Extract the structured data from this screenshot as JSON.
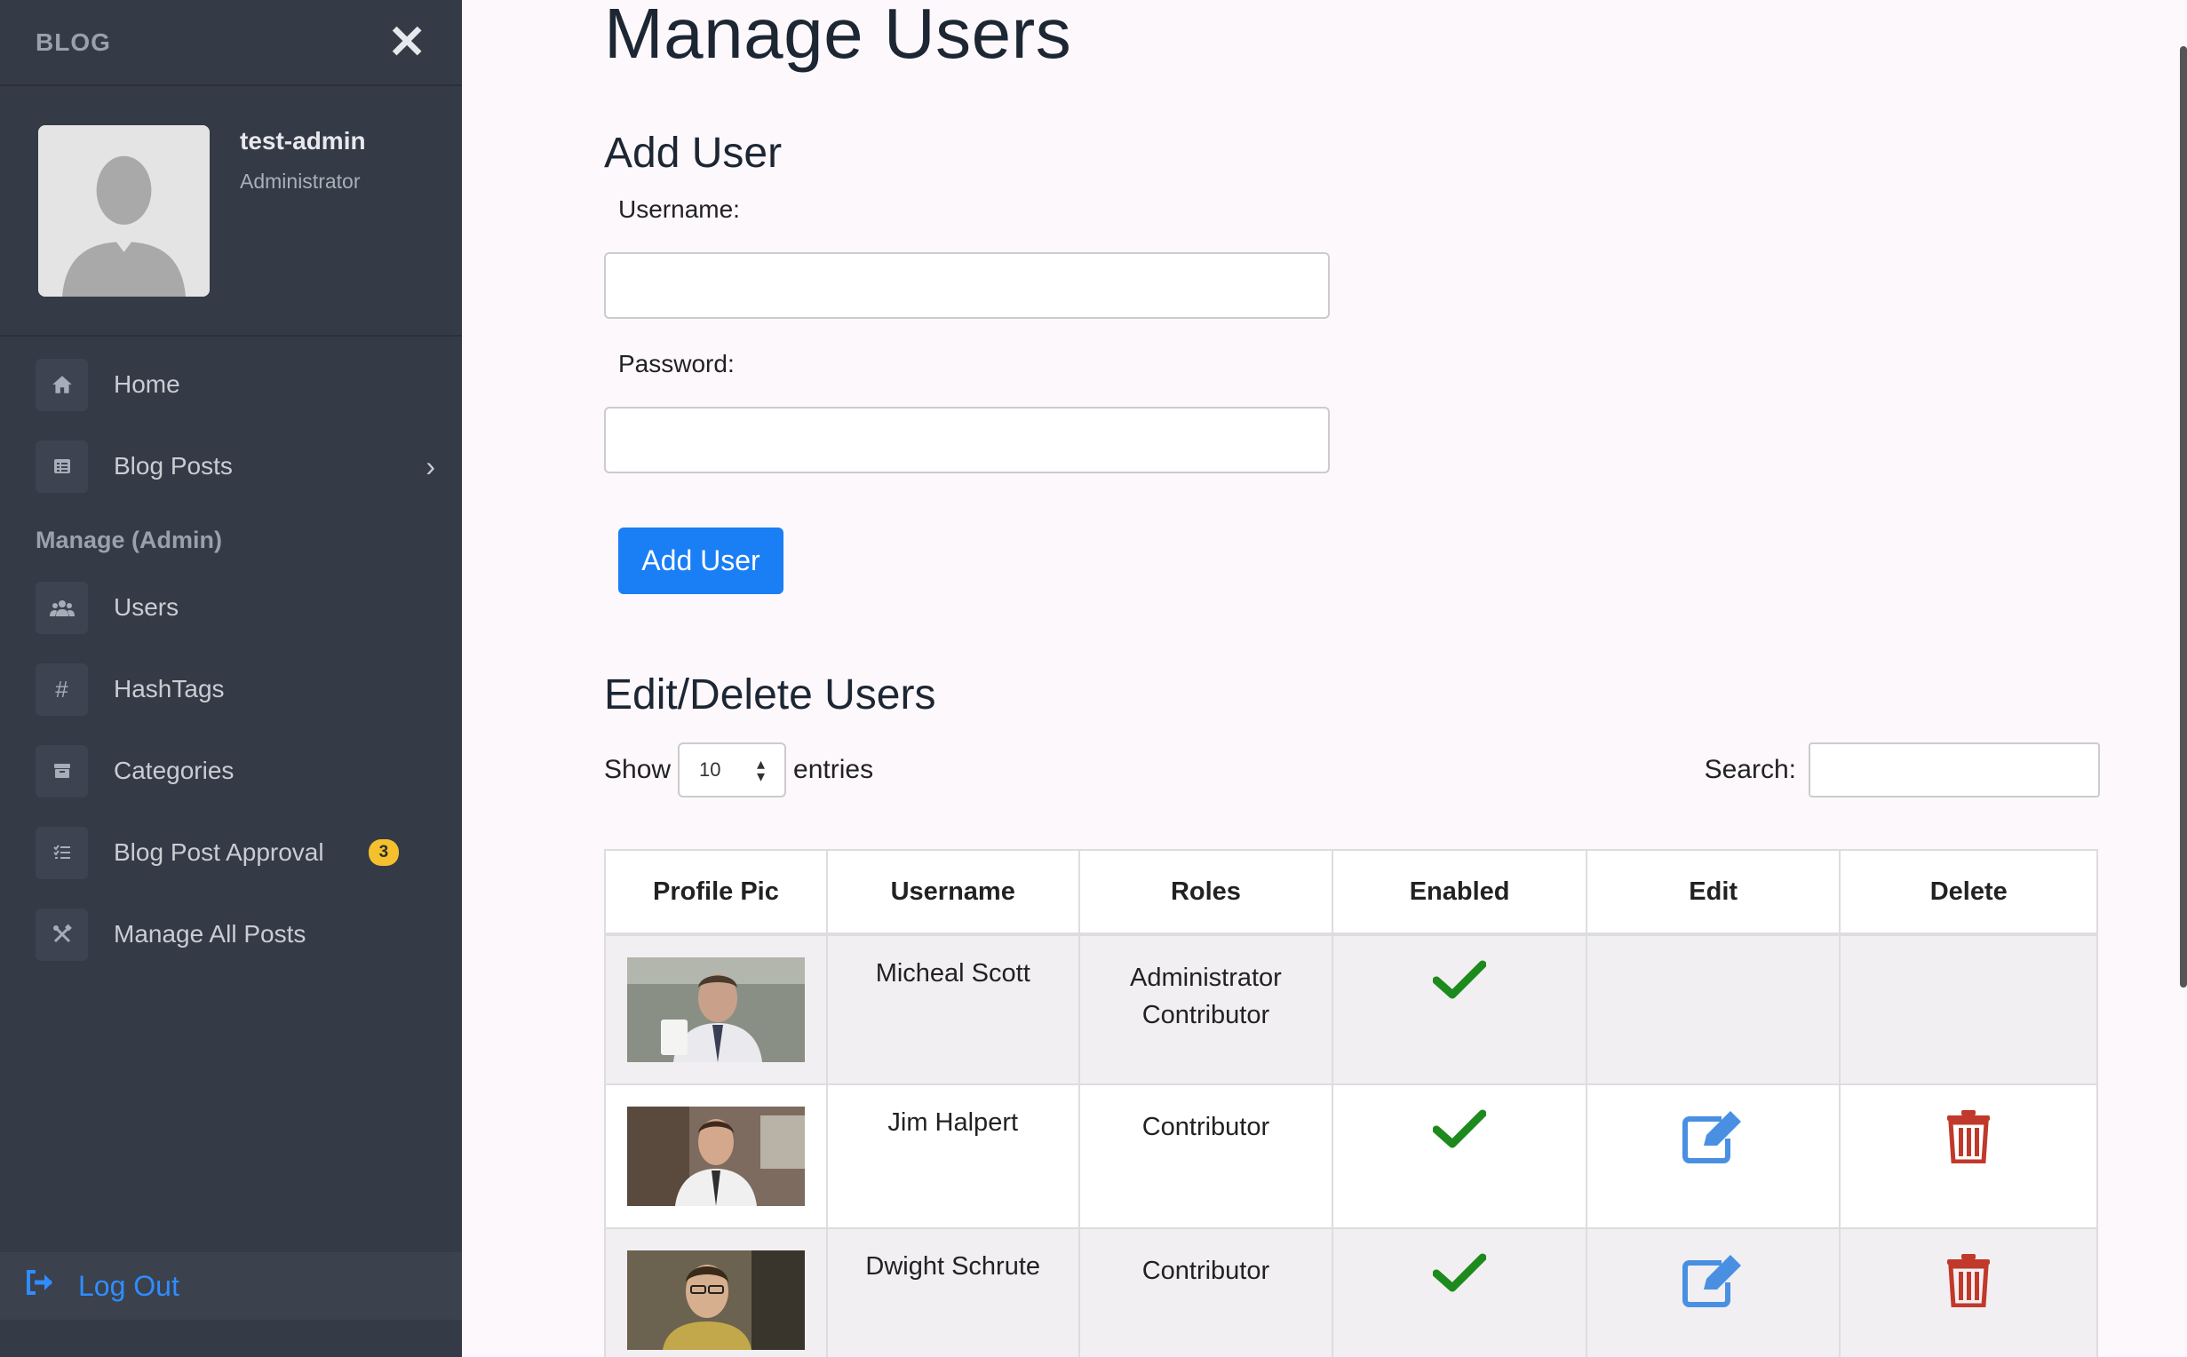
{
  "sidebar": {
    "brand": "BLOG",
    "close_icon": "✕",
    "profile": {
      "name": "test-admin",
      "role": "Administrator"
    },
    "items": [
      {
        "label": "Home",
        "icon": "home-icon"
      },
      {
        "label": "Blog Posts",
        "icon": "list-icon",
        "chevron": "›"
      }
    ],
    "section_label": "Manage (Admin)",
    "admin_items": [
      {
        "label": "Users",
        "icon": "users-icon"
      },
      {
        "label": "HashTags",
        "icon": "hashtag-icon",
        "glyph": "#"
      },
      {
        "label": "Categories",
        "icon": "archive-icon"
      },
      {
        "label": "Blog Post Approval",
        "icon": "tasks-icon",
        "badge": "3"
      },
      {
        "label": "Manage All Posts",
        "icon": "tools-icon"
      }
    ],
    "logout": {
      "label": "Log Out",
      "icon": "sign-out-icon"
    }
  },
  "main": {
    "title": "Manage Users",
    "add_user": {
      "heading": "Add User",
      "username_label": "Username:",
      "password_label": "Password:",
      "username_value": "",
      "password_value": "",
      "button_label": "Add User"
    },
    "edit_users": {
      "heading": "Edit/Delete Users",
      "show_label": "Show",
      "entries_value": "10",
      "entries_label": "entries",
      "search_label": "Search:",
      "search_value": "",
      "columns": [
        "Profile Pic",
        "Username",
        "Roles",
        "Enabled",
        "Edit",
        "Delete"
      ],
      "rows": [
        {
          "username": "Micheal Scott",
          "roles": [
            "Administrator",
            "Contributor"
          ],
          "enabled": true,
          "editable": false
        },
        {
          "username": "Jim Halpert",
          "roles": [
            "Contributor"
          ],
          "enabled": true,
          "editable": true
        },
        {
          "username": "Dwight Schrute",
          "roles": [
            "Contributor"
          ],
          "enabled": true,
          "editable": true
        }
      ]
    }
  },
  "colors": {
    "sidebar_bg": "#343a46",
    "accent": "#1a7ef5",
    "check": "#1d8a1d",
    "edit_icon": "#4a90e2",
    "delete_icon": "#c0392b",
    "badge": "#f4c02d"
  }
}
